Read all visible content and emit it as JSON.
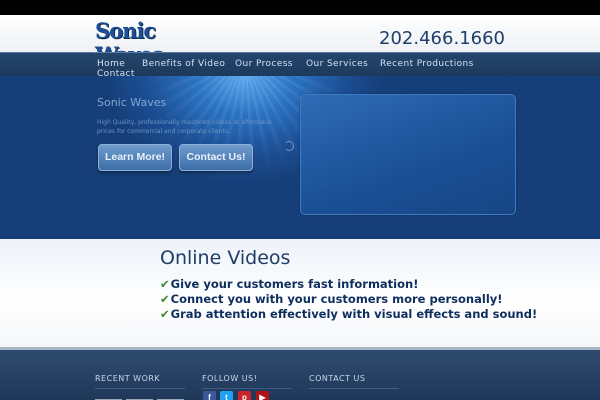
{
  "header": {
    "logo_line1": "Sonic",
    "logo_line2": "Waves",
    "phone": "202.466.1660"
  },
  "nav": {
    "items": [
      "Home",
      "Benefits of Video",
      "Our Process",
      "Our Services",
      "Recent Productions",
      "Contact"
    ]
  },
  "hero": {
    "title": "Sonic Waves",
    "description": "High Quality, professionally mastered videos at affordable prices for commercial and corporate clients.",
    "learn_more_label": "Learn More!",
    "contact_label": "Contact Us!"
  },
  "content": {
    "title": "Online Videos",
    "bullets": [
      "Give your customers fast information!",
      "Connect you with your customers more personally!",
      "Grab attention effectively with visual effects and sound!"
    ],
    "check_glyph": "✔"
  },
  "footer": {
    "recent_work": "RECENT WORK",
    "follow_us": "FOLLOW US!",
    "contact_us": "CONTACT US",
    "social_icons": [
      "facebook-icon",
      "twitter-icon",
      "pinterest-icon",
      "youtube-icon"
    ],
    "social_glyphs": [
      "f",
      "t",
      "p",
      "▶"
    ]
  },
  "colors": {
    "brand_blue": "#1d4f94",
    "check_green": "#3a8a2a",
    "nav_bg": "#24456c"
  }
}
